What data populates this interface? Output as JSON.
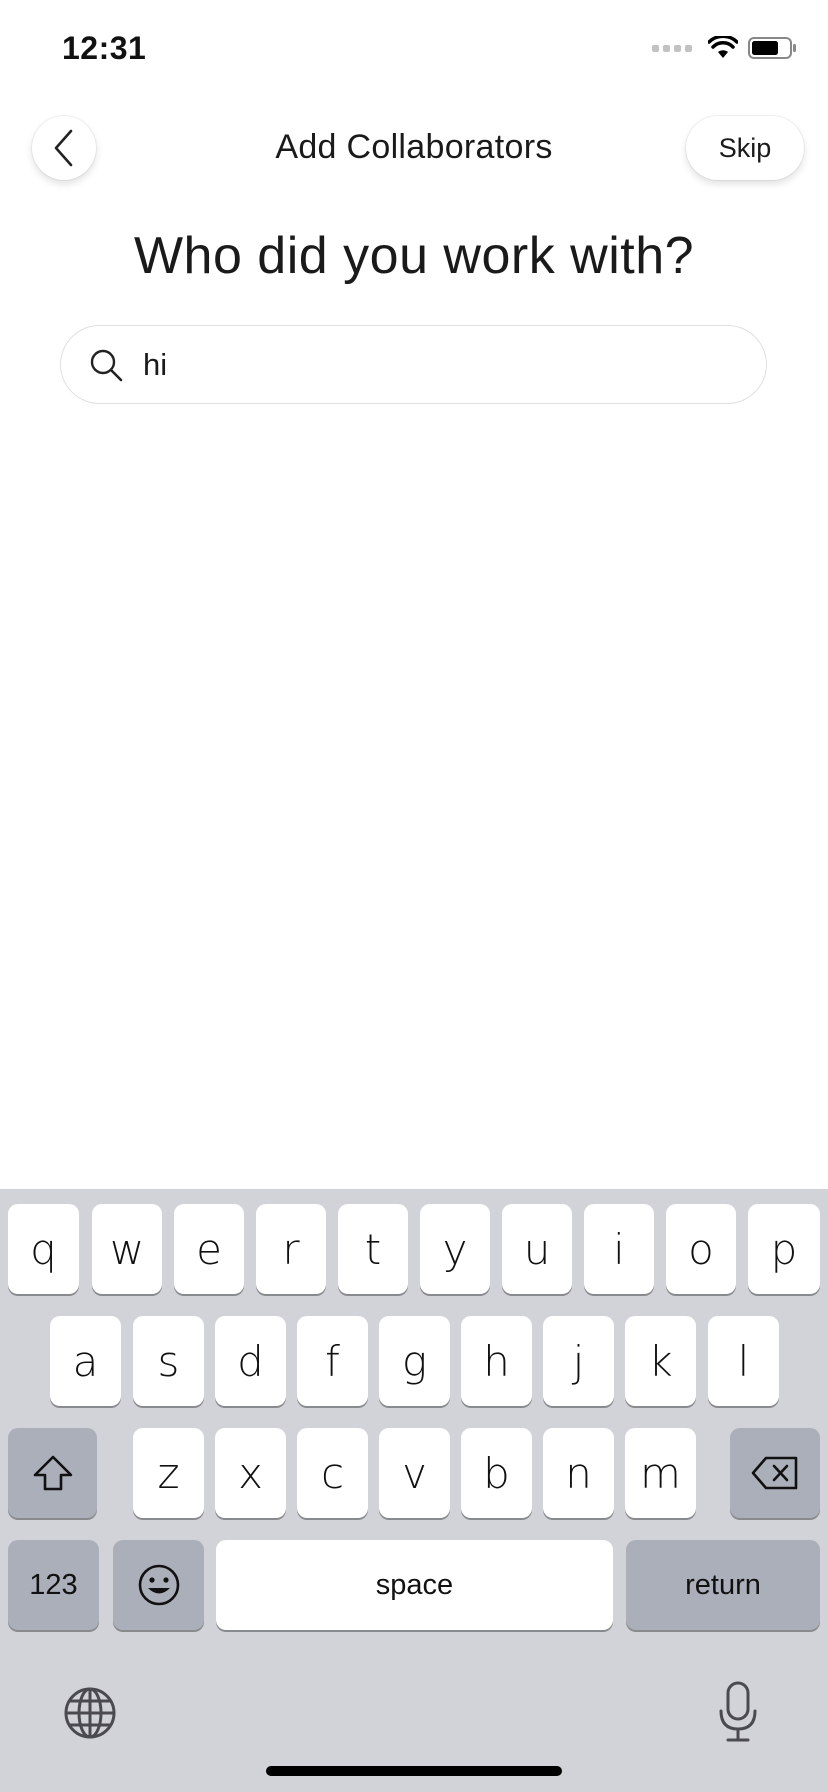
{
  "status_bar": {
    "time": "12:31",
    "icons": [
      "cellular-signal-icon",
      "wifi-icon",
      "battery-icon"
    ]
  },
  "header": {
    "back_icon": "chevron-left-icon",
    "title": "Add Collaborators",
    "skip_label": "Skip"
  },
  "prompt": "Who did you work with?",
  "search": {
    "icon": "search-icon",
    "value": "hi"
  },
  "keyboard": {
    "row1": [
      "q",
      "w",
      "e",
      "r",
      "t",
      "y",
      "u",
      "i",
      "o",
      "p"
    ],
    "row2": [
      "a",
      "s",
      "d",
      "f",
      "g",
      "h",
      "j",
      "k",
      "l"
    ],
    "row3": [
      "z",
      "x",
      "c",
      "v",
      "b",
      "n",
      "m"
    ],
    "numbers_label": "123",
    "space_label": "space",
    "return_label": "return",
    "icons": [
      "shift-icon",
      "backspace-icon",
      "emoji-icon",
      "globe-icon",
      "microphone-icon"
    ]
  },
  "colors": {
    "keyboard_bg": "#d1d3d9",
    "key_bg": "#ffffff",
    "function_key_bg": "#abafba"
  }
}
